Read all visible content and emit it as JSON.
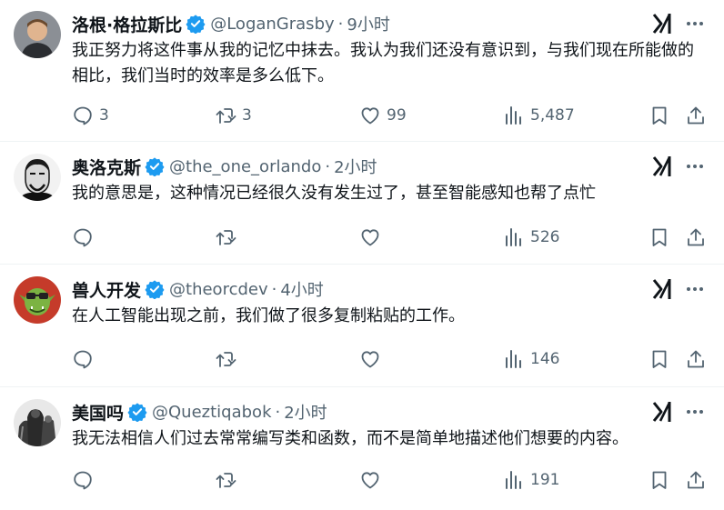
{
  "tweets": [
    {
      "name": "洛根·格拉斯比",
      "handle": "@LoganGrasby",
      "time": "9小时",
      "text": "我正努力将这件事从我的记忆中抹去。我认为我们还没有意识到，与我们现在所能做的相比，我们当时的效率是多么低下。",
      "replies": "3",
      "retweets": "3",
      "likes": "99",
      "views": "5,487"
    },
    {
      "name": "奥洛克斯",
      "handle": "@the_one_orlando",
      "time": "2小时",
      "text": "我的意思是，这种情况已经很久没有发生过了，甚至智能感知也帮了点忙",
      "replies": "",
      "retweets": "",
      "likes": "",
      "views": "526"
    },
    {
      "name": "兽人开发",
      "handle": "@theorcdev",
      "time": "4小时",
      "text": "在人工智能出现之前，我们做了很多复制粘贴的工作。",
      "replies": "",
      "retweets": "",
      "likes": "",
      "views": "146"
    },
    {
      "name": "美国吗",
      "handle": "@Queztiqabok",
      "time": "2小时",
      "text": "我无法相信人们过去常常编写类和函数，而不是简单地描述他们想要的内容。",
      "replies": "",
      "retweets": "",
      "likes": "",
      "views": "191"
    }
  ],
  "separator": "·",
  "colors": {
    "verified": "#1d9bf0",
    "secondary_text": "#536471",
    "primary_text": "#0f1419",
    "divider": "#eff3f4"
  },
  "icons": [
    "verified-badge-icon",
    "grok-icon",
    "more-icon",
    "reply-icon",
    "retweet-icon",
    "like-icon",
    "views-icon",
    "bookmark-icon",
    "share-icon"
  ]
}
